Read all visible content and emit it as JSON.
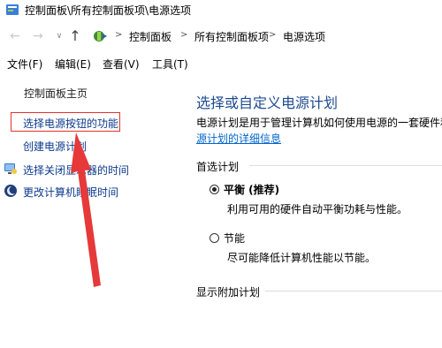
{
  "window": {
    "title": "控制面板\\所有控制面板项\\电源选项"
  },
  "navigation": {
    "back": "←",
    "forward": "→",
    "recent": "∨",
    "up": "↑",
    "breadcrumb": [
      "控制面板",
      "所有控制面板项",
      "电源选项"
    ],
    "separator": ">"
  },
  "menu": {
    "items": [
      "文件(F)",
      "编辑(E)",
      "查看(V)",
      "工具(T)"
    ]
  },
  "sidebar": {
    "home": "控制面板主页",
    "links": [
      {
        "label": "选择电源按钮的功能",
        "highlighted": true
      },
      {
        "label": "创建电源计划",
        "highlighted": false
      },
      {
        "label": "选择关闭显示器的时间",
        "icon": "display-icon"
      },
      {
        "label": "更改计算机睡眠时间",
        "icon": "moon-icon"
      }
    ]
  },
  "main": {
    "title": "选择或自定义电源计划",
    "description": "电源计划是用于管理计算机如何使用电源的一套硬件和",
    "detail_link": "源计划的详细信息",
    "preferred_section": "首选计划",
    "plans": [
      {
        "name": "平衡 (推荐)",
        "description": "利用可用的硬件自动平衡功耗与性能。",
        "selected": true
      },
      {
        "name": "节能",
        "description": "尽可能降低计算机性能以节能。",
        "selected": false
      }
    ],
    "extra_section": "显示附加计划"
  },
  "colors": {
    "title_blue": "#1e4b8f",
    "link_blue": "#0066cc",
    "highlight_red": "#e0322d"
  }
}
